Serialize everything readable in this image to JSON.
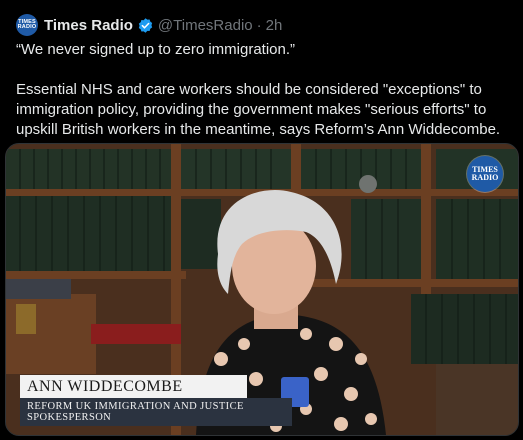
{
  "account": {
    "avatar_text_line1": "TIMES",
    "avatar_text_line2": "RADIO",
    "name": "Times Radio",
    "handle": "@TimesRadio",
    "separator": "·",
    "time": "2h"
  },
  "tweet": {
    "line1": "“We never signed up to zero immigration.”",
    "body": "Essential NHS and care workers should be considered \"exceptions\" to immigration policy, providing the government makes \"serious efforts\" to upskill British workers in the meantime, says Reform’s Ann Widdecombe."
  },
  "media": {
    "logo_line1": "TIMES",
    "logo_line2": "RADIO",
    "caption_name": "ANN WIDDECOMBE",
    "caption_title": "REFORM UK IMMIGRATION AND JUSTICE SPOKESPERSON"
  },
  "colors": {
    "background": "#000000",
    "text": "#e7e9ea",
    "secondary": "#71767b",
    "verified": "#1d9bf0",
    "brand": "#1f5aa6"
  }
}
